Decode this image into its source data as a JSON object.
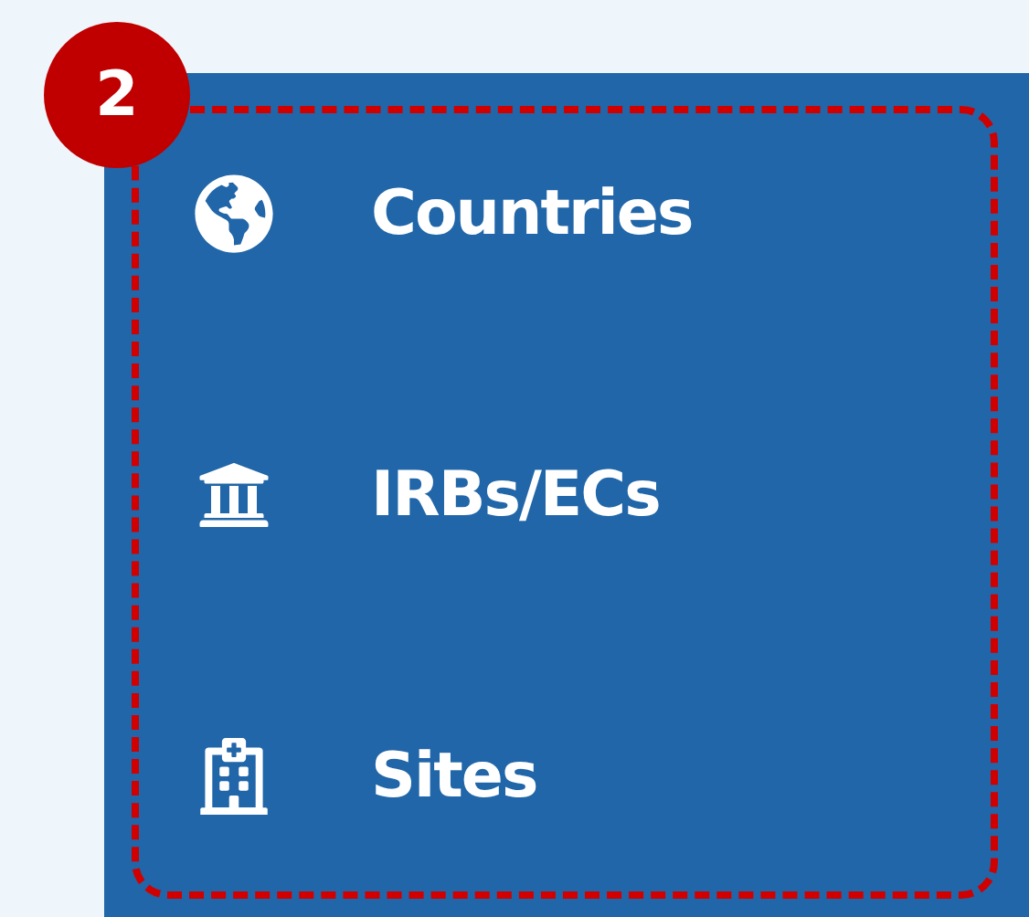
{
  "badge": "2",
  "menu": {
    "items": [
      {
        "label": "Countries",
        "kind": "globe"
      },
      {
        "label": "IRBs/ECs",
        "kind": "institution"
      },
      {
        "label": "Sites",
        "kind": "hospital"
      }
    ]
  }
}
